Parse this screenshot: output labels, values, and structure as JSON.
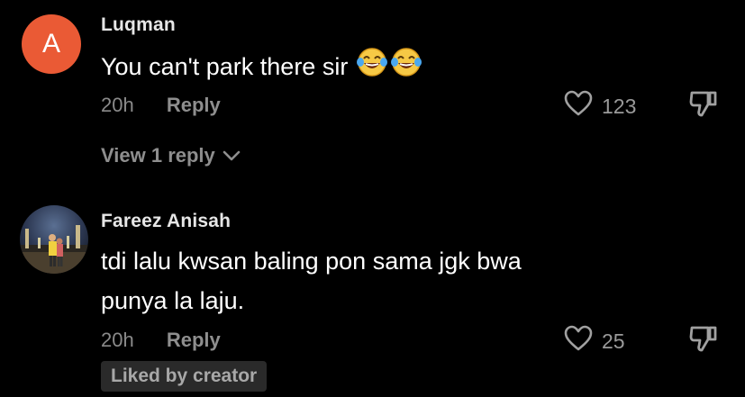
{
  "comments": [
    {
      "avatar_letter": "A",
      "username": "Luqman",
      "text": "You can't park there sir",
      "emoji": [
        "face-with-tears-of-joy",
        "face-with-tears-of-joy"
      ],
      "time": "20h",
      "reply_label": "Reply",
      "likes": "123",
      "view_replies_label": "View 1 reply"
    },
    {
      "username": "Fareez Anisah",
      "text_line1": "tdi lalu kwsan baling pon sama jgk bwa",
      "text_line2": "punya la laju.",
      "time": "20h",
      "reply_label": "Reply",
      "likes": "25",
      "badge": "Liked by creator"
    }
  ],
  "colors": {
    "background": "#000000",
    "avatar_a": "#ea5a35",
    "muted_text": "#8a8a8a",
    "badge_bg": "#2a2a2a"
  }
}
